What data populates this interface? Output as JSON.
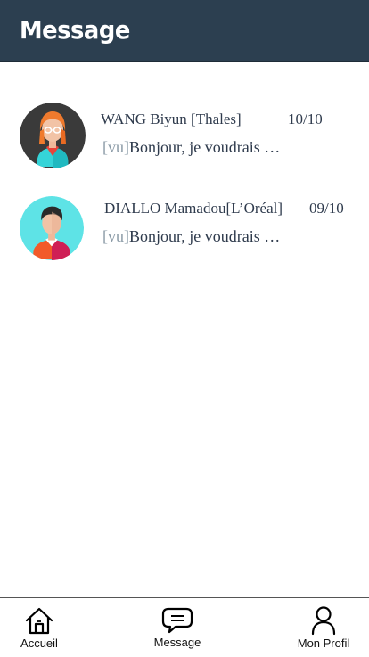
{
  "header": {
    "title": "Message"
  },
  "messages": [
    {
      "name": "WANG Biyun [Thales]",
      "date": "10/10",
      "status": "[vu]",
      "preview": "Bonjour, je voudrais …",
      "avatar_icon": "female-avatar-icon"
    },
    {
      "name": "DIALLO Mamadou[L’Oréal]",
      "date": "09/10",
      "status": "[vu]",
      "preview": "Bonjour, je voudrais …",
      "avatar_icon": "male-avatar-icon"
    }
  ],
  "tabbar": {
    "items": [
      {
        "label": "Accueil",
        "icon": "home-icon"
      },
      {
        "label": "Message",
        "icon": "chat-icon"
      },
      {
        "label": "Mon Profil",
        "icon": "user-icon"
      }
    ]
  },
  "colors": {
    "header_bg": "#2c3f50",
    "text": "#2e3a4c",
    "seen": "#8a9aa6"
  }
}
